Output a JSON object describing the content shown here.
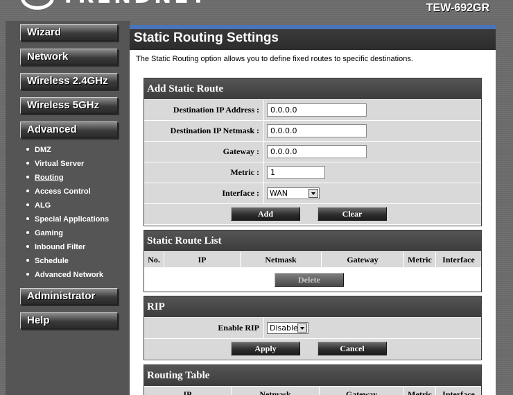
{
  "header": {
    "logo_text": "TRENDNET",
    "model": "TEW-692GR"
  },
  "sidebar": {
    "top_items": [
      {
        "label": "Wizard"
      },
      {
        "label": "Network"
      },
      {
        "label": "Wireless 2.4GHz"
      },
      {
        "label": "Wireless 5GHz"
      },
      {
        "label": "Advanced"
      }
    ],
    "sub_items": [
      {
        "label": "DMZ"
      },
      {
        "label": "Virtual Server"
      },
      {
        "label": "Routing"
      },
      {
        "label": "Access Control"
      },
      {
        "label": "ALG"
      },
      {
        "label": "Special Applications"
      },
      {
        "label": "Gaming"
      },
      {
        "label": "Inbound Filter"
      },
      {
        "label": "Schedule"
      },
      {
        "label": "Advanced Network"
      }
    ],
    "active_sub": "Routing",
    "bottom_items": [
      {
        "label": "Administrator"
      },
      {
        "label": "Help"
      }
    ]
  },
  "page": {
    "title": "Static Routing Settings",
    "description": "The Static Routing option allows you to define fixed routes to specific destinations."
  },
  "add_route": {
    "heading": "Add Static Route",
    "dest_ip_label": "Destination IP Address :",
    "dest_ip_value": "0.0.0.0",
    "netmask_label": "Destination IP Netmask :",
    "netmask_value": "0.0.0.0",
    "gateway_label": "Gateway :",
    "gateway_value": "0.0.0.0",
    "metric_label": "Metric :",
    "metric_value": "1",
    "interface_label": "Interface :",
    "interface_value": "WAN",
    "add_button": "Add",
    "clear_button": "Clear"
  },
  "route_list": {
    "heading": "Static Route List",
    "columns": [
      "No.",
      "IP",
      "Netmask",
      "Gateway",
      "Metric",
      "Interface"
    ],
    "delete_button": "Delete"
  },
  "rip": {
    "heading": "RIP",
    "enable_label": "Enable RIP",
    "enable_value": "Disable",
    "apply_button": "Apply",
    "cancel_button": "Cancel"
  },
  "routing_table": {
    "heading": "Routing Table",
    "columns": [
      "IP",
      "Netmask",
      "Gateway",
      "Metric",
      "Interface"
    ]
  },
  "colors": {
    "accent": "#4a74b9",
    "panel_head": "#3c3c3c",
    "row_bg": "#d9d9d9"
  }
}
